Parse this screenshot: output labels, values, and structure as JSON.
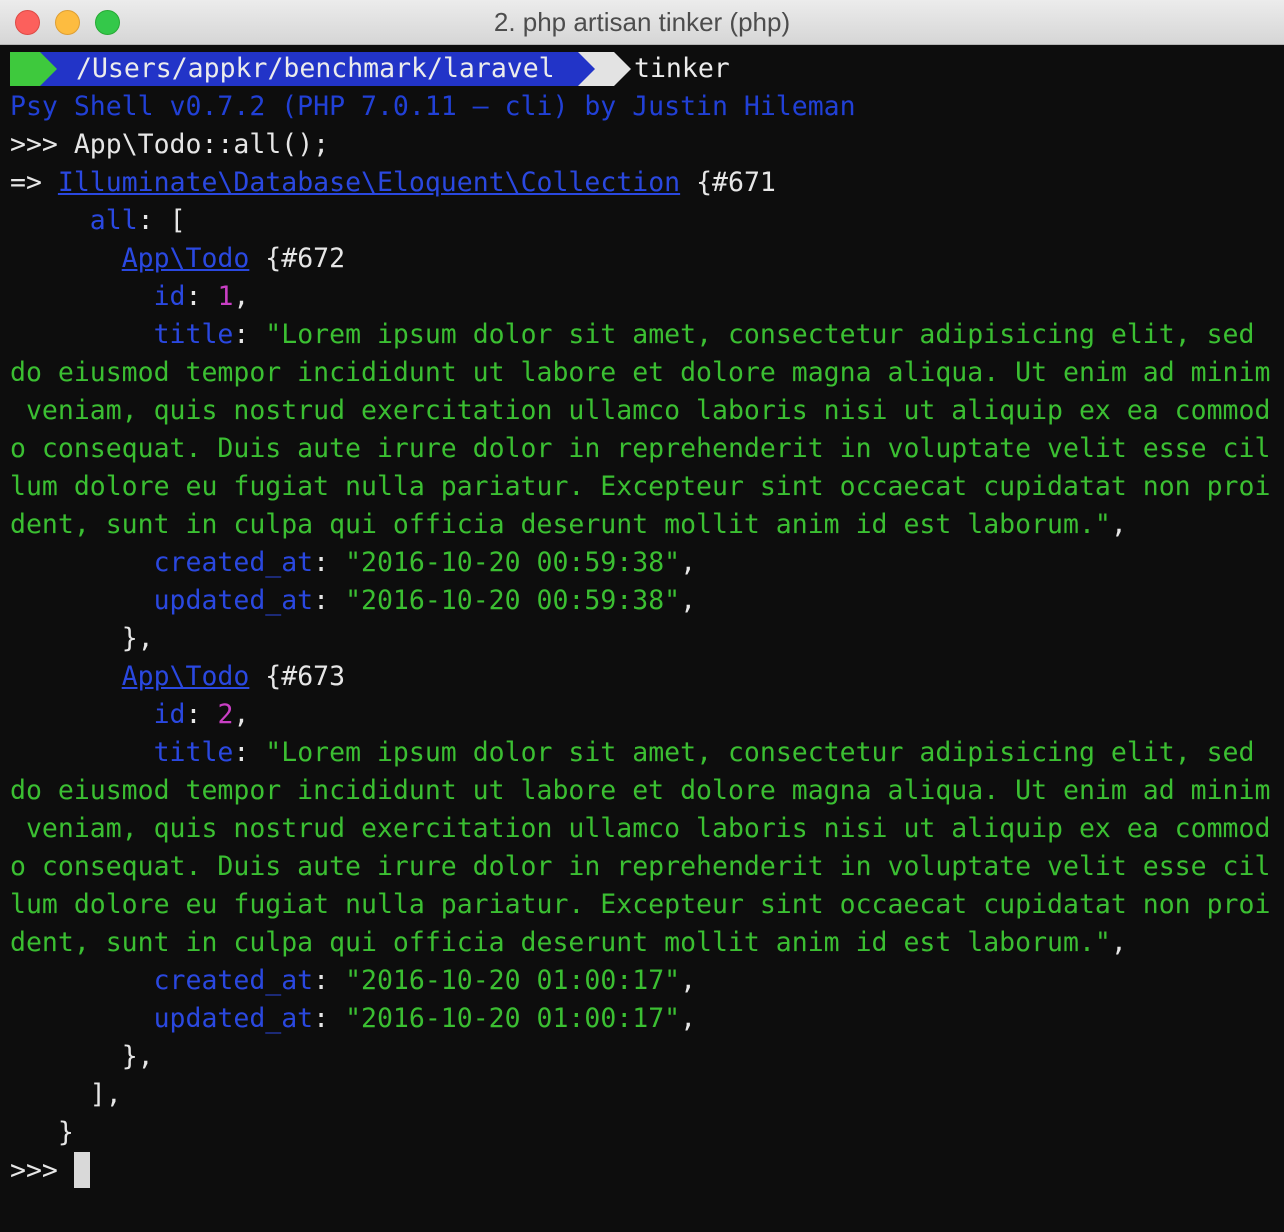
{
  "window": {
    "title": "2. php artisan tinker (php)"
  },
  "prompt": {
    "path": "/Users/appkr/benchmark/laravel",
    "command": "tinker"
  },
  "banner": "Psy Shell v0.7.2 (PHP 7.0.11 — cli) by Justin Hileman",
  "input": {
    "prompt_symbol": ">>>",
    "command": " App\\Todo::all();"
  },
  "output": {
    "arrow": "=>",
    "collection_class": "Illuminate\\Database\\Eloquent\\Collection",
    "collection_ref": " {#671",
    "all_key": "all",
    "all_open": ": [",
    "records": [
      {
        "class": "App\\Todo",
        "ref": " {#672",
        "id": "1",
        "title_lines": [
          "\"Lorem ipsum dolor sit amet, consectetur adipisicing elit, sed",
          "do eiusmod tempor incididunt ut labore et dolore magna aliqua. Ut enim ad minim",
          " veniam, quis nostrud exercitation ullamco laboris nisi ut aliquip ex ea commod",
          "o consequat. Duis aute irure dolor in reprehenderit in voluptate velit esse cil",
          "lum dolore eu fugiat nulla pariatur. Excepteur sint occaecat cupidatat non proi",
          "dent, sunt in culpa qui officia deserunt mollit anim id est laborum.\""
        ],
        "created_at": "\"2016-10-20 00:59:38\"",
        "updated_at": "\"2016-10-20 00:59:38\""
      },
      {
        "class": "App\\Todo",
        "ref": " {#673",
        "id": "2",
        "title_lines": [
          "\"Lorem ipsum dolor sit amet, consectetur adipisicing elit, sed",
          "do eiusmod tempor incididunt ut labore et dolore magna aliqua. Ut enim ad minim",
          " veniam, quis nostrud exercitation ullamco laboris nisi ut aliquip ex ea commod",
          "o consequat. Duis aute irure dolor in reprehenderit in voluptate velit esse cil",
          "lum dolore eu fugiat nulla pariatur. Excepteur sint occaecat cupidatat non proi",
          "dent, sunt in culpa qui officia deserunt mollit anim id est laborum.\""
        ],
        "created_at": "\"2016-10-20 01:00:17\"",
        "updated_at": "\"2016-10-20 01:00:17\""
      }
    ],
    "keys": {
      "id": "id",
      "title": "title",
      "created_at": "created_at",
      "updated_at": "updated_at"
    },
    "record_close": "},",
    "all_close": "],",
    "collection_close": "}"
  },
  "final_prompt": ">>>",
  "colors": {
    "background": "#0d0d0d",
    "keyword_blue": "#2a48e0",
    "string_green": "#3bbf32",
    "number_magenta": "#c93fc4",
    "powerline_green": "#3ec93d",
    "powerline_blue": "#2234c8"
  }
}
